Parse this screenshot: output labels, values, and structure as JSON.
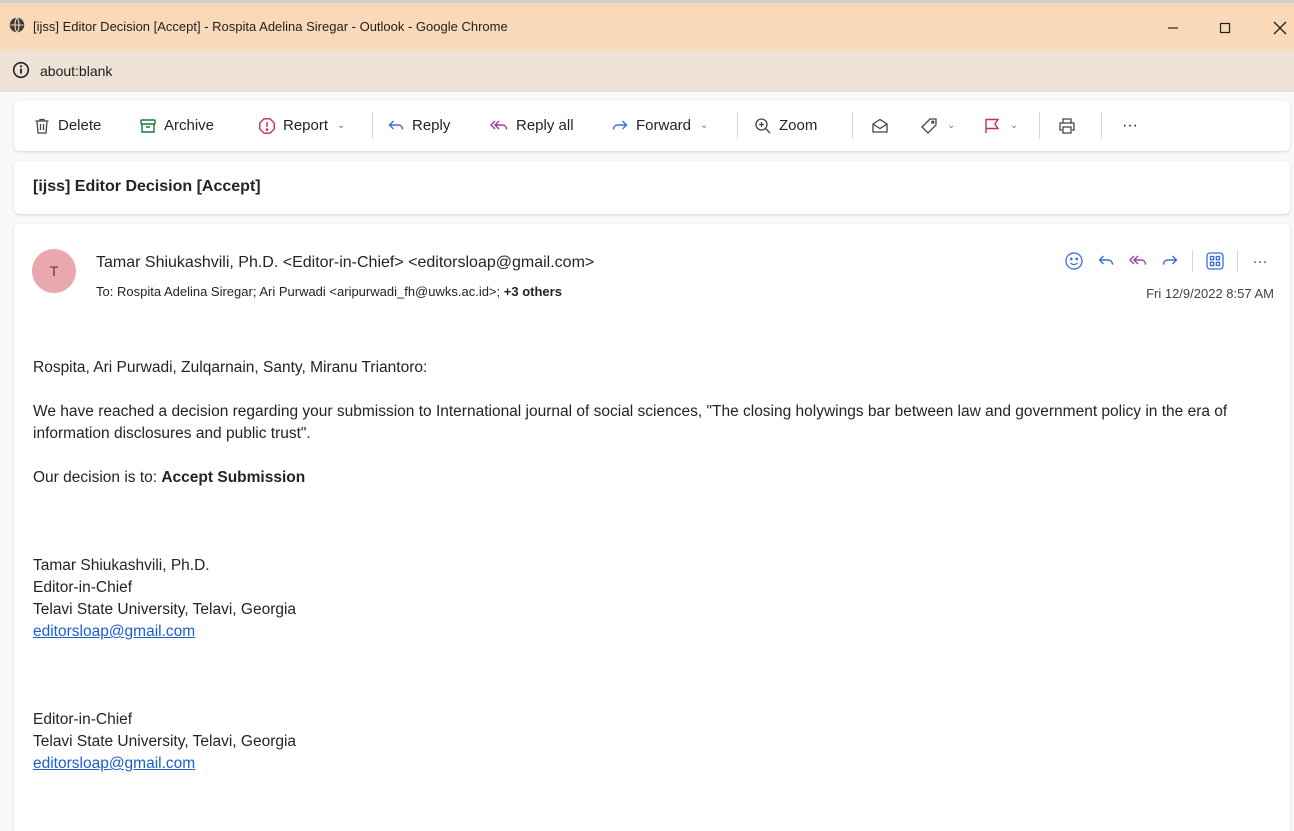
{
  "window": {
    "title": "[ijss] Editor Decision [Accept] - Rospita Adelina Siregar - Outlook - Google Chrome",
    "url": "about:blank"
  },
  "toolbar": {
    "delete": "Delete",
    "archive": "Archive",
    "report": "Report",
    "reply": "Reply",
    "reply_all": "Reply all",
    "forward": "Forward",
    "zoom": "Zoom",
    "more": "···"
  },
  "subject": "[ijss] Editor Decision [Accept]",
  "message": {
    "avatar_initial": "T",
    "from": "Tamar Shiukashvili, Ph.D. <Editor-in-Chief> <editorsloap@gmail.com>",
    "to_label": "To:",
    "to_recipients": "Rospita Adelina Siregar;  Ari Purwadi <aripurwadi_fh@uwks.ac.id>;",
    "to_more": "+3 others",
    "date": "Fri 12/9/2022 8:57 AM",
    "more": "···"
  },
  "body": {
    "greeting": "Rospita, Ari Purwadi, Zulqarnain, Santy, Miranu Triantoro:",
    "paragraph1": "We have reached a decision regarding your submission to International journal of social sciences, \"The closing holywings bar between law and government policy in the era of information disclosures and public trust\".",
    "decision_prefix": "Our decision is to: ",
    "decision": "Accept Submission",
    "sig1_name": "Tamar Shiukashvili, Ph.D.",
    "sig1_role": "Editor-in-Chief",
    "sig1_org": "Telavi State University, Telavi, Georgia",
    "sig1_email": "editorsloap@gmail.com",
    "sig2_role": "Editor-in-Chief",
    "sig2_org": "Telavi State University, Telavi, Georgia",
    "sig2_email": "editorsloap@gmail.com"
  },
  "icons": {
    "window_minimize": "minimize-icon",
    "window_maximize": "maximize-icon",
    "window_close": "close-icon",
    "address_info": "info-icon",
    "delete": "trash-icon",
    "archive": "archive-icon",
    "report": "report-icon",
    "reply": "reply-icon",
    "reply_all": "reply-all-icon",
    "forward": "forward-icon",
    "zoom": "zoom-icon",
    "read": "envelope-icon",
    "tag": "tag-icon",
    "flag": "flag-icon",
    "print": "print-icon",
    "emoji": "smiley-icon",
    "apps": "apps-icon"
  },
  "colors": {
    "titlebar": "#f9d9b7",
    "addressbar": "#eee2d6",
    "accent": "#3b6fd6",
    "flag": "#c4314b",
    "avatar": "#e8a8ae",
    "link": "#1a5fd0"
  }
}
